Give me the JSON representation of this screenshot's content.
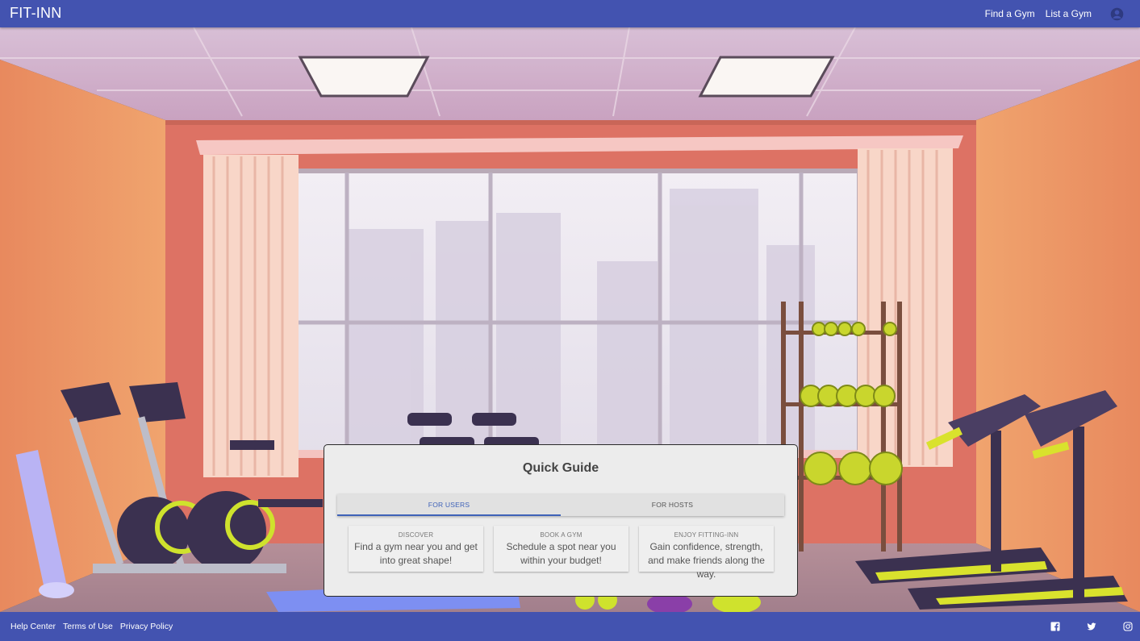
{
  "header": {
    "brand": "FIT-INN",
    "nav": [
      {
        "label": "Find a Gym"
      },
      {
        "label": "List a Gym"
      }
    ],
    "account_icon": "account-circle-icon"
  },
  "colors": {
    "primary": "#4353b0",
    "tab_active": "#3f62b8",
    "card_bg": "#ececec"
  },
  "guide": {
    "title": "Quick Guide",
    "tabs": [
      {
        "label": "FOR USERS",
        "active": true
      },
      {
        "label": "FOR HOSTS",
        "active": false
      }
    ],
    "steps": [
      {
        "label": "DISCOVER",
        "text": "Find a gym near you and get into great shape!"
      },
      {
        "label": "BOOK A GYM",
        "text": "Schedule a spot near you within your budget!"
      },
      {
        "label": "ENJOY FITTING-INN",
        "text": "Gain confidence, strength, and make friends along the way."
      }
    ]
  },
  "footer": {
    "links": [
      {
        "label": "Help Center"
      },
      {
        "label": "Terms of Use"
      },
      {
        "label": "Privacy Policy"
      }
    ],
    "social_icons": [
      "facebook-icon",
      "twitter-icon",
      "instagram-icon"
    ]
  }
}
